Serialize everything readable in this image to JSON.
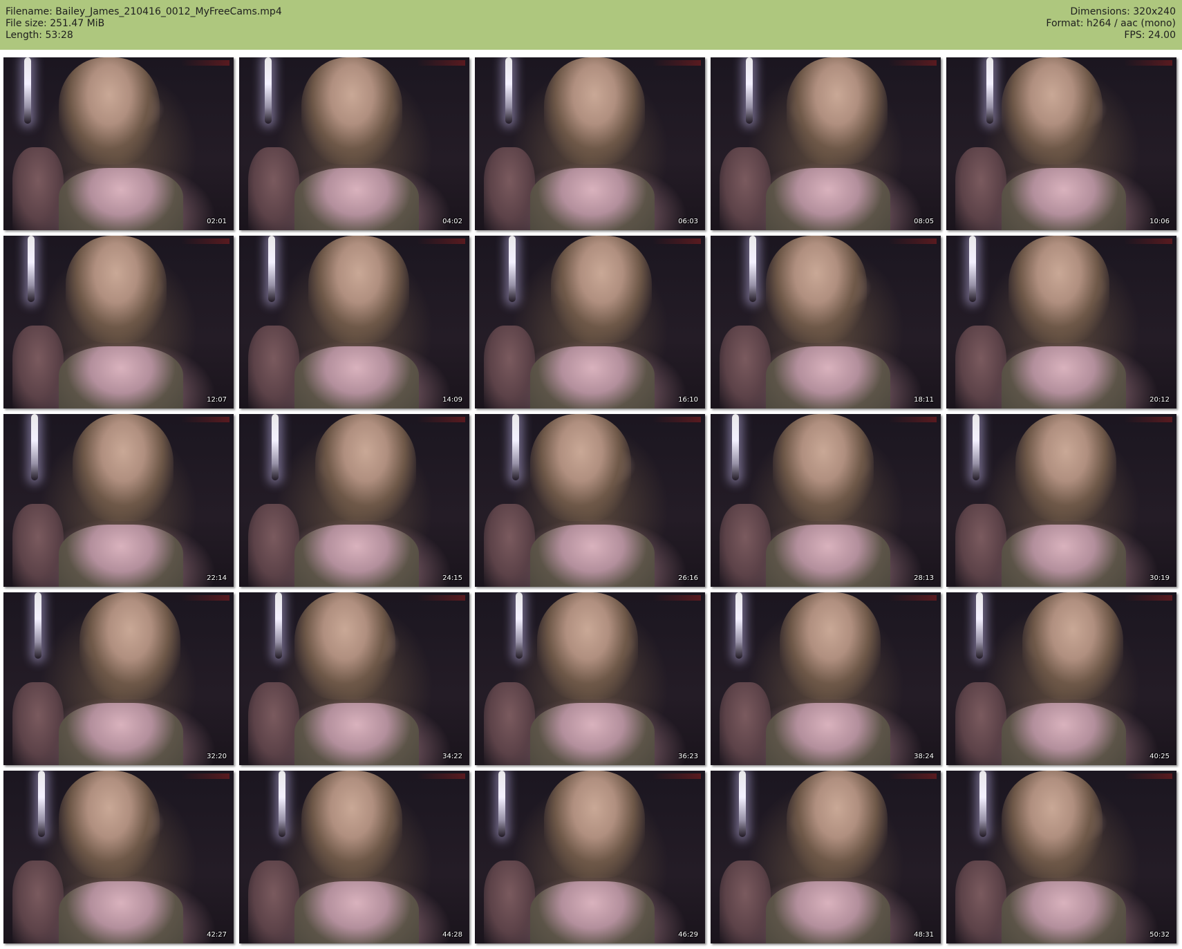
{
  "header": {
    "filename_label": "Filename: Bailey_James_210416_0012_MyFreeCams.mp4",
    "filesize_label": "File size: 251.47 MiB",
    "length_label": "Length: 53:28",
    "dimensions_label": "Dimensions: 320x240",
    "format_label": "Format: h264 / aac (mono)",
    "fps_label": "FPS: 24.00"
  },
  "colors": {
    "header_background": "#aec77e",
    "page_background": "#ffffff",
    "timestamp_text": "#ffffff"
  },
  "thumbnails": [
    {
      "timestamp": "02:01"
    },
    {
      "timestamp": "04:02"
    },
    {
      "timestamp": "06:03"
    },
    {
      "timestamp": "08:05"
    },
    {
      "timestamp": "10:06"
    },
    {
      "timestamp": "12:07"
    },
    {
      "timestamp": "14:09"
    },
    {
      "timestamp": "16:10"
    },
    {
      "timestamp": "18:11"
    },
    {
      "timestamp": "20:12"
    },
    {
      "timestamp": "22:14"
    },
    {
      "timestamp": "24:15"
    },
    {
      "timestamp": "26:16"
    },
    {
      "timestamp": "28:13"
    },
    {
      "timestamp": "30:19"
    },
    {
      "timestamp": "32:20"
    },
    {
      "timestamp": "34:22"
    },
    {
      "timestamp": "36:23"
    },
    {
      "timestamp": "38:24"
    },
    {
      "timestamp": "40:25"
    },
    {
      "timestamp": "42:27"
    },
    {
      "timestamp": "44:28"
    },
    {
      "timestamp": "46:29"
    },
    {
      "timestamp": "48:31"
    },
    {
      "timestamp": "50:32"
    }
  ]
}
